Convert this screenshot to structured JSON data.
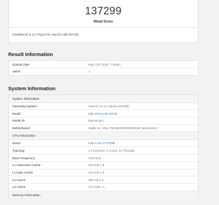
{
  "score": {
    "value": "137299",
    "label": "Metal Score",
    "benchmark_caption": "Geekbench 5.4.4 Tryout for macOS x86 (64-bit)"
  },
  "result_information": {
    "title": "Result Information",
    "rows": [
      {
        "key": "Upload Date",
        "value": "May 11th 2022, 7:36am"
      },
      {
        "key": "Views",
        "value": "1"
      }
    ]
  },
  "system_information": {
    "title": "System Information",
    "system_group": {
      "heading": "System Information",
      "rows": [
        {
          "key": "Operating System",
          "value": "macOS 12.3.1 (Build 21E258)"
        },
        {
          "key": "Model",
          "value": "Mac mini (Late 2018)"
        },
        {
          "key": "Model ID",
          "value": "Macmini8,1"
        },
        {
          "key": "Motherboard",
          "value": "Apple Inc. Mac-7BA5B2DFE22DDD8C Macmini8,1"
        }
      ]
    },
    "cpu_group": {
      "heading": "CPU Information",
      "rows": [
        {
          "key": "Name",
          "value": "Intel Core i7-8700B"
        },
        {
          "key": "Topology",
          "value": "1 Processor, 6 Cores, 12 Threads"
        },
        {
          "key": "Base Frequency",
          "value": "3.20 GHz"
        },
        {
          "key": "L1 Instruction Cache",
          "value": "32.0 KB x 6"
        },
        {
          "key": "L1 Data Cache",
          "value": "32.0 KB x 6"
        },
        {
          "key": "L2 Cache",
          "value": "256 KB x 6"
        },
        {
          "key": "L3 Cache",
          "value": "12.0 MB x 1"
        }
      ]
    },
    "memory_group": {
      "heading": "Memory Information"
    }
  },
  "colors": {
    "background": "#f2f2f2",
    "card": "#ffffff",
    "link": "#3a74c4",
    "muted_text": "#777777"
  }
}
